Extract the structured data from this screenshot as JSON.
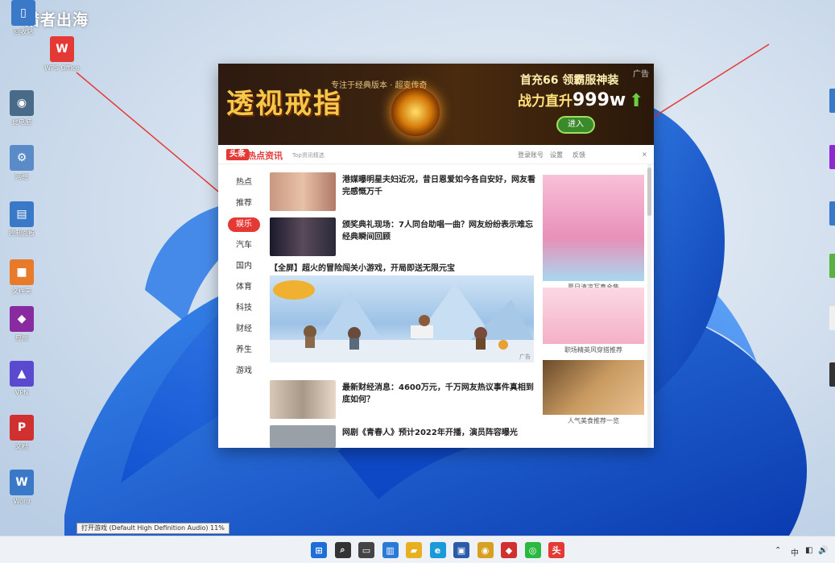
{
  "watermark": "猎者出海",
  "desktop": {
    "left_icons": [
      {
        "label": "回收站",
        "color": "#3a78c8",
        "glyph": "▯"
      },
      {
        "label": "WPS Office",
        "color": "#e53935",
        "glyph": "W"
      },
      {
        "label": "此电脑",
        "color": "#4a6a8a",
        "glyph": "◉"
      },
      {
        "label": "网络",
        "color": "#5a8ac8",
        "glyph": "⚙"
      },
      {
        "label": "控制面板",
        "color": "#3a78c8",
        "glyph": "▤"
      },
      {
        "label": "文件夹",
        "color": "#e87a2a",
        "glyph": "■"
      },
      {
        "label": "应用",
        "color": "#8a2aa0",
        "glyph": "◆"
      },
      {
        "label": "VPN",
        "color": "#5a4ad0",
        "glyph": "▲"
      },
      {
        "label": "文档",
        "color": "#d03030",
        "glyph": "P"
      },
      {
        "label": "Word",
        "color": "#3a78c8",
        "glyph": "W"
      }
    ]
  },
  "popup": {
    "banner": {
      "title": "透视戒指",
      "slogan": "专注于经典版本 · 超变传奇",
      "promo_line1": "首充66 领霸服神装",
      "promo_line2_prefix": "战力直升",
      "promo_line2_value": "999w",
      "enter_label": "进入",
      "ad_label": "广告"
    },
    "header": {
      "logo_badge": "头条",
      "logo_text": "热点资讯",
      "logo_sub": "Top资讯精选",
      "links": [
        "登录账号",
        "设置",
        "反馈",
        "×"
      ]
    },
    "categories": [
      {
        "label": "热点",
        "active": false
      },
      {
        "label": "推荐",
        "active": false
      },
      {
        "label": "娱乐",
        "active": true
      },
      {
        "label": "汽车",
        "active": false
      },
      {
        "label": "国内",
        "active": false
      },
      {
        "label": "体育",
        "active": false
      },
      {
        "label": "科技",
        "active": false
      },
      {
        "label": "财经",
        "active": false
      },
      {
        "label": "养生",
        "active": false
      },
      {
        "label": "游戏",
        "active": false
      }
    ],
    "news": [
      {
        "title": "港媒曝明星夫妇近况，昔日恩爱如今各自安好，网友看完感慨万千",
        "thumb": "#d8a890"
      },
      {
        "title": "颁奖典礼现场：7人同台助唱一曲？网友纷纷表示难忘经典瞬间回顾",
        "thumb": "#2a2a3a"
      },
      {
        "title": "最新财经消息：4600万元，千万网友热议事件真相到底如何？",
        "thumb": "#c8b8a8"
      },
      {
        "title": "网剧《青春人》预计2022年开播，演员阵容曝光",
        "thumb": "#9aa0a8"
      }
    ],
    "big_item": {
      "title": "【全屏】超火的冒险闯关小游戏，开局即送无限元宝",
      "ad_tag": "广告"
    },
    "side_ads": [
      {
        "caption": "夏日清凉写真合集",
        "color": "#f4a8c8"
      },
      {
        "caption": "职场精英风穿搭推荐",
        "color": "#f8c8d8"
      },
      {
        "caption": "人气美食推荐一览",
        "color": "#c89a60"
      }
    ]
  },
  "tooltip": "打开游戏 (Default High Definition Audio) 11%",
  "taskbar": {
    "apps": [
      {
        "name": "start-icon",
        "color": "#1e6ed8",
        "glyph": "⊞"
      },
      {
        "name": "search-icon",
        "color": "#333333",
        "glyph": "⌕"
      },
      {
        "name": "task-view-icon",
        "color": "#444444",
        "glyph": "▭"
      },
      {
        "name": "widgets-icon",
        "color": "#2a7ad8",
        "glyph": "▥"
      },
      {
        "name": "file-explorer-icon",
        "color": "#e8b020",
        "glyph": "▰"
      },
      {
        "name": "edge-icon",
        "color": "#1a9ad8",
        "glyph": "e"
      },
      {
        "name": "store-icon",
        "color": "#2a5aa8",
        "glyph": "▣"
      },
      {
        "name": "chrome-icon",
        "color": "#d8a020",
        "glyph": "◉"
      },
      {
        "name": "app-icon",
        "color": "#d03030",
        "glyph": "◆"
      },
      {
        "name": "wechat-icon",
        "color": "#2ab840",
        "glyph": "◎"
      },
      {
        "name": "news-app-icon",
        "color": "#e53935",
        "glyph": "头"
      }
    ],
    "tray_symbols": [
      "⌃",
      "中",
      "◧",
      "🔊"
    ]
  }
}
